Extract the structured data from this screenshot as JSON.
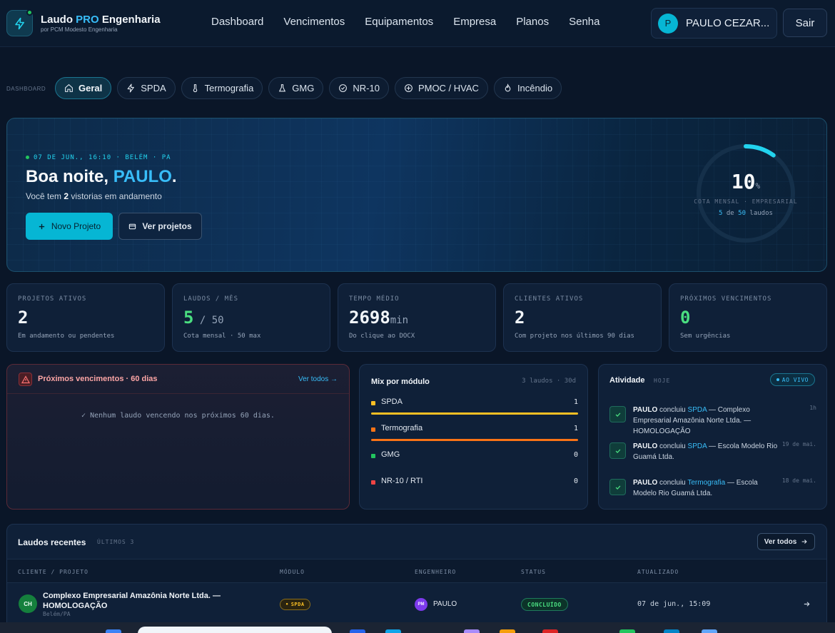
{
  "app": {
    "brand_name": "Laudo",
    "brand_highlight": "PRO",
    "brand_suffix": "Engenharia",
    "brand_subtitle": "por PCM Modesto Engenharia"
  },
  "nav": {
    "items": [
      "Dashboard",
      "Vencimentos",
      "Equipamentos",
      "Empresa",
      "Planos",
      "Senha"
    ],
    "user_initial": "P",
    "user_name": "PAULO CEZAR...",
    "logout_label": "Sair"
  },
  "tabs": {
    "breadcrumb": "DASHBOARD",
    "items": [
      {
        "label": "Geral",
        "icon": "home-icon",
        "active": true
      },
      {
        "label": "SPDA",
        "icon": "bolt-icon",
        "active": false
      },
      {
        "label": "Termografia",
        "icon": "thermometer-icon",
        "active": false
      },
      {
        "label": "GMG",
        "icon": "flask-icon",
        "active": false
      },
      {
        "label": "NR-10",
        "icon": "check-circle-icon",
        "active": false
      },
      {
        "label": "PMOC / HVAC",
        "icon": "plus-circle-icon",
        "active": false
      },
      {
        "label": "Incêndio",
        "icon": "flame-icon",
        "active": false
      }
    ]
  },
  "hero": {
    "datetime": "07 DE JUN., 16:10 · BELÉM · PA",
    "greeting": "Boa noite,",
    "name": "PAULO",
    "greeting_end": ".",
    "status_prefix": "Você tem",
    "status_count": "2",
    "status_suffix": "vistorias em andamento",
    "new_project_label": "Novo Projeto",
    "view_projects_label": "Ver projetos",
    "quota": {
      "percent": "10",
      "percent_sign": "%",
      "fraction": 0.1,
      "label": "COTA MENSAL · EMPRESARIAL",
      "used": "5",
      "of": "de",
      "total": "50",
      "unit": "laudos"
    }
  },
  "stats": [
    {
      "label": "PROJETOS ATIVOS",
      "value": "2",
      "suffix": "",
      "desc": "Em andamento ou pendentes",
      "color": "#f1f5f9"
    },
    {
      "label": "LAUDOS / MÊS",
      "value": "5",
      "suffix": " / 50",
      "desc": "Cota mensal · 50 max",
      "color": "#4ade80"
    },
    {
      "label": "TEMPO MÉDIO",
      "value": "2698",
      "suffix": "min",
      "desc": "Do clique ao DOCX",
      "color": "#f1f5f9"
    },
    {
      "label": "CLIENTES ATIVOS",
      "value": "2",
      "suffix": "",
      "desc": "Com projeto nos últimos 90 dias",
      "color": "#f1f5f9"
    },
    {
      "label": "PRÓXIMOS VENCIMENTOS",
      "value": "0",
      "suffix": "",
      "desc": "Sem urgências",
      "color": "#4ade80"
    }
  ],
  "due": {
    "title": "Próximos vencimentos · 60 dias",
    "link": "Ver todos →",
    "empty": "✓ Nenhum laudo vencendo nos próximos 60 dias."
  },
  "mix": {
    "title": "Mix por módulo",
    "meta": "3 laudos · 30d",
    "rows": [
      {
        "label": "SPDA",
        "count": "1",
        "color": "#fbbf24",
        "fraction": 1.0
      },
      {
        "label": "Termografia",
        "count": "1",
        "color": "#f97316",
        "fraction": 1.0
      },
      {
        "label": "GMG",
        "count": "0",
        "color": "#22c55e",
        "fraction": 0
      },
      {
        "label": "NR-10 / RTI",
        "count": "0",
        "color": "#ef4444",
        "fraction": 0
      }
    ]
  },
  "activity": {
    "title": "Atividade",
    "today": "HOJE",
    "live": "AO VIVO",
    "items": [
      {
        "user": "PAULO",
        "verb": "concluiu",
        "module": "SPDA",
        "target": "— Complexo Empresarial Amazônia Norte Ltda. — HOMOLOGAÇÃO",
        "time": "1h"
      },
      {
        "user": "PAULO",
        "verb": "concluiu",
        "module": "SPDA",
        "target": "— Escola Modelo Rio Guamá Ltda.",
        "time": "19 de mai."
      },
      {
        "user": "PAULO",
        "verb": "concluiu",
        "module": "Termografia",
        "target": "— Escola Modelo Rio Guamá Ltda.",
        "time": "18 de mai."
      }
    ]
  },
  "recent": {
    "title": "Laudos recentes",
    "subtitle": "ÚLTIMOS 3",
    "view_all": "Ver todos",
    "columns": [
      "CLIENTE / PROJETO",
      "MÓDULO",
      "ENGENHEIRO",
      "STATUS",
      "ATUALIZADO"
    ],
    "rows": [
      {
        "initials": "CH",
        "client": "Complexo Empresarial Amazônia Norte Ltda. — HOMOLOGAÇÃO",
        "location": "Belém/PA",
        "module": "SPDA",
        "engineer_initials": "PM",
        "engineer": "PAULO",
        "status": "CONCLUÍDO",
        "updated": "07 de jun., 15:09"
      }
    ]
  }
}
